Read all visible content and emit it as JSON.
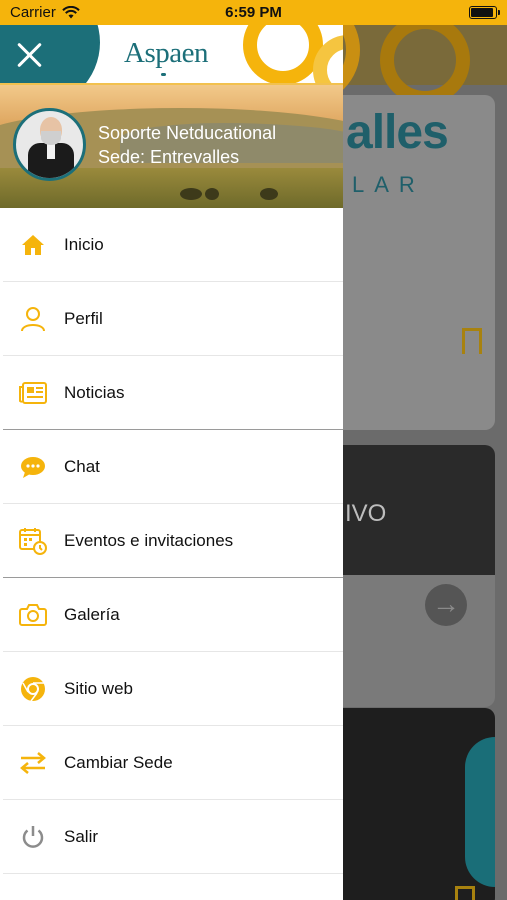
{
  "status_bar": {
    "carrier": "Carrier",
    "time": "6:59 PM",
    "battery_level": 0.9
  },
  "drawer": {
    "logo_text": "Aspaen",
    "profile": {
      "name": "Soporte Netducational",
      "sede": "Sede: Entrevalles"
    },
    "menu": [
      {
        "label": "Inicio",
        "icon": "home-icon"
      },
      {
        "label": "Perfil",
        "icon": "user-icon"
      },
      {
        "label": "Noticias",
        "icon": "newspaper-icon"
      },
      {
        "label": "Chat",
        "icon": "chat-bubble-icon"
      },
      {
        "label": "Eventos e invitaciones",
        "icon": "calendar-clock-icon"
      },
      {
        "label": "Galería",
        "icon": "camera-icon"
      },
      {
        "label": "Sitio web",
        "icon": "chrome-icon"
      },
      {
        "label": "Cambiar Sede",
        "icon": "swap-arrows-icon"
      },
      {
        "label": "Salir",
        "icon": "power-icon"
      }
    ]
  },
  "background": {
    "brand_fragment": "alles",
    "brand_sub_fragment": "LAR",
    "card_text_fragment": "IVO"
  },
  "colors": {
    "accent": "#f5b40c",
    "teal": "#1c6f79",
    "icon_gray": "#8c8c8c"
  }
}
